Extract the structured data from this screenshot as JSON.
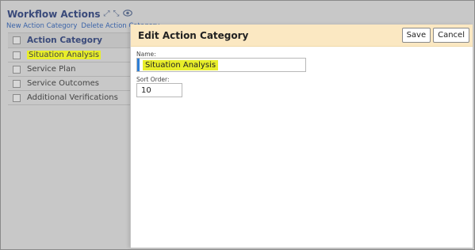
{
  "workflow": {
    "title": "Workflow Actions",
    "icons": [
      "expand-icon",
      "collapse-icon",
      "eye-icon"
    ],
    "links": [
      "New Action Category",
      "Delete Action Category"
    ]
  },
  "categories": {
    "header": "Action Category",
    "items": [
      "Situation Analysis",
      "Service Plan",
      "Service Outcomes",
      "Additional Verifications"
    ],
    "highlighted_index": 0
  },
  "dialog": {
    "title": "Edit Action Category",
    "save_label": "Save",
    "cancel_label": "Cancel",
    "name_label": "Name:",
    "name_value": "Situation Analysis",
    "sort_label": "Sort Order:",
    "sort_value": "10"
  },
  "colors": {
    "highlight": "#e8ee2a",
    "dialog_header": "#fbe8c2",
    "focus_accent": "#2e7fd6",
    "title_text": "#3a4a7a",
    "link_text": "#3a63a8"
  }
}
